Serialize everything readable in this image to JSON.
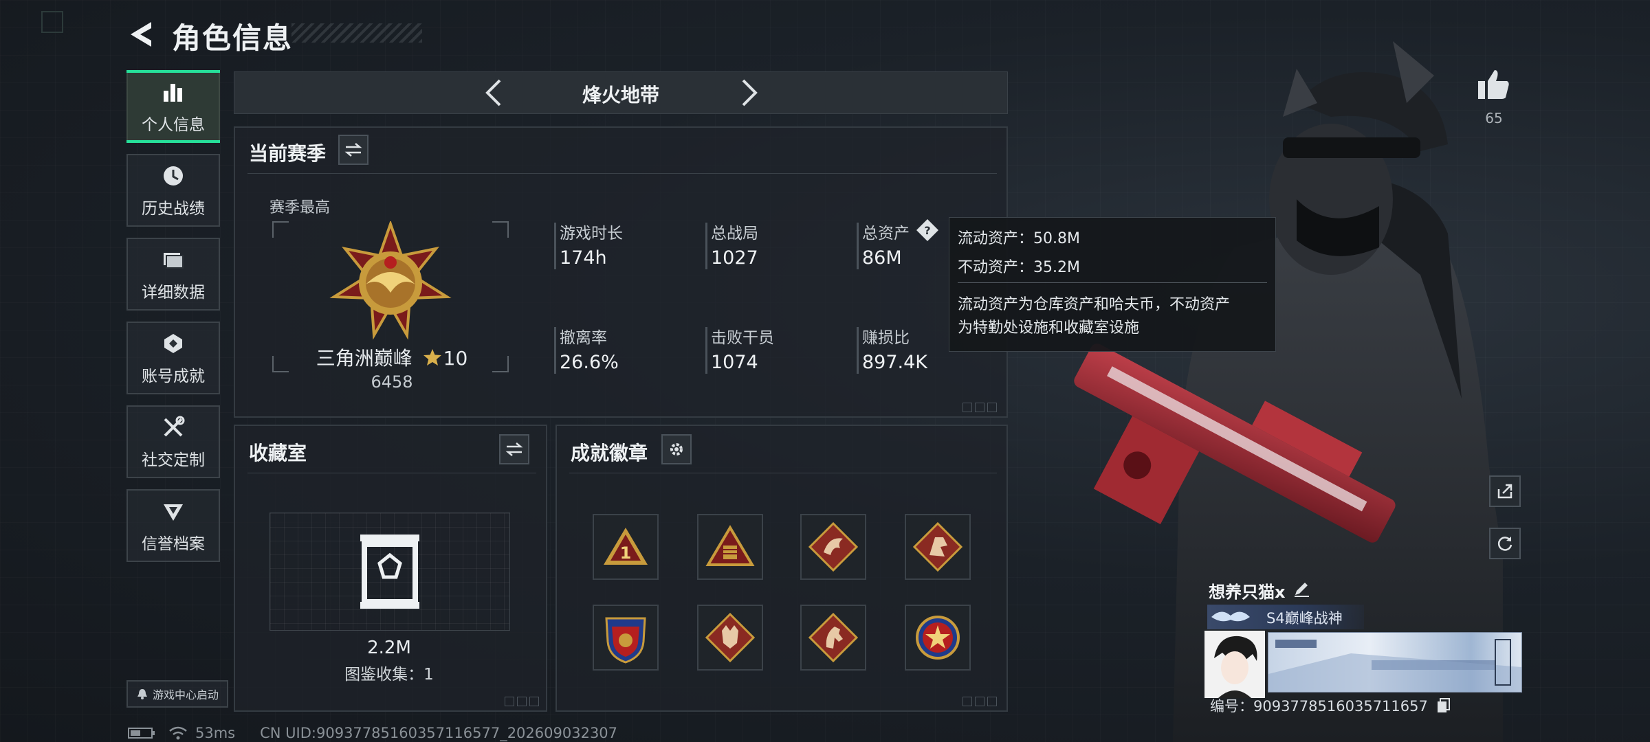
{
  "header": {
    "title": "角色信息"
  },
  "sidebar": {
    "items": [
      {
        "label": "个人信息",
        "icon": "bar-chart-icon",
        "active": true
      },
      {
        "label": "历史战绩",
        "icon": "clock-icon"
      },
      {
        "label": "详细数据",
        "icon": "folders-icon"
      },
      {
        "label": "账号成就",
        "icon": "achievement-icon"
      },
      {
        "label": "社交定制",
        "icon": "tools-icon"
      },
      {
        "label": "信誉档案",
        "icon": "credit-shield-icon"
      }
    ],
    "game_center_label": "游戏中心启动"
  },
  "game_tabs": {
    "current": "烽火地带"
  },
  "season": {
    "title": "当前赛季",
    "subtitle": "赛季最高",
    "rank_name": "三角洲巅峰",
    "rank_stars": "10",
    "rank_score": "6458",
    "stats": [
      {
        "label": "游戏时长",
        "value": "174h"
      },
      {
        "label": "总战局",
        "value": "1027"
      },
      {
        "label": "总资产",
        "value": "86M"
      },
      {
        "label": "撤离率",
        "value": "26.6%"
      },
      {
        "label": "击败干员",
        "value": "1074"
      },
      {
        "label": "赚损比",
        "value": "897.4K"
      }
    ]
  },
  "tooltip": {
    "liquid": "流动资产：50.8M",
    "fixed": "不动资产：35.2M",
    "desc_line1": "流动资产为仓库资产和哈夫币，不动资产",
    "desc_line2": "为特勤处设施和收藏室设施"
  },
  "collection": {
    "title": "收藏室",
    "value": "2.2M",
    "count_label": "图鉴收集：1"
  },
  "badges": {
    "title": "成就徽章",
    "items": [
      "rank-1-badge-icon",
      "triangle-badge-icon",
      "dragon-badge-icon",
      "soldier-badge-icon",
      "shield-wing-badge-icon",
      "wolf-badge-icon",
      "horse-badge-icon",
      "star-emblem-badge-icon"
    ]
  },
  "profile": {
    "likes": "65",
    "player_name": "想养只猫x",
    "title_text": "S4巅峰战神",
    "uid_line": "编号：9093778516035711657"
  },
  "status": {
    "ping": "53ms",
    "uid": "CN UID:90937785160357116577_202609032307"
  },
  "colors": {
    "accent": "#26e09a",
    "panel": "#1e2329",
    "tooltip_bg": "#14171b"
  }
}
